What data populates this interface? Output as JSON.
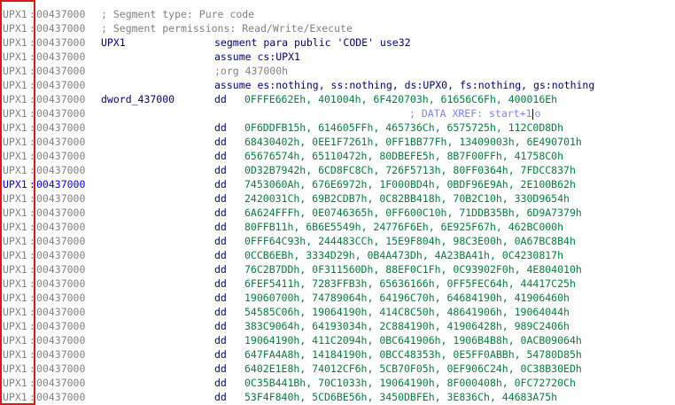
{
  "colors": {
    "address_grey": "#808080",
    "selected_blue": "#0000ff",
    "keyword_navy": "#000080",
    "operand_green": "#008040",
    "xref_blue": "#8080ff",
    "highlight_red": "#e0161b"
  },
  "rows": [
    {
      "seg": "UPX1",
      "addr": "00437000",
      "text": "; Segment type: Pure code"
    },
    {
      "seg": "UPX1",
      "addr": "00437000",
      "text": "; Segment permissions: Read/Write/Execute"
    },
    {
      "seg": "UPX1",
      "addr": "00437000",
      "label": "UPX1",
      "mnem": "segment para public 'CODE' use32"
    },
    {
      "seg": "UPX1",
      "addr": "00437000",
      "mnem": "assume cs:UPX1"
    },
    {
      "seg": "UPX1",
      "addr": "00437000",
      "comment": ";org 437000h"
    },
    {
      "seg": "UPX1",
      "addr": "00437000",
      "mnem": "assume es:nothing, ss:nothing, ds:UPX0, fs:nothing, gs:nothing"
    },
    {
      "seg": "UPX1",
      "addr": "00437000",
      "label": "dword_437000",
      "mnem": "dd",
      "ops": "0FFFE662Eh, 401004h, 6F420703h, 61656C6Fh, 400016Eh"
    },
    {
      "seg": "UPX1",
      "addr": "00437000",
      "xref_pre": "; DATA XREF: start+1",
      "xref_post": "o"
    },
    {
      "seg": "UPX1",
      "addr": "00437000",
      "mnem": "dd",
      "ops": "0F6DDFB15h, 614605FFh, 465736Ch, 6575725h, 112C0D8Dh"
    },
    {
      "seg": "UPX1",
      "addr": "00437000",
      "mnem": "dd",
      "ops": "68430402h, 0EE1F7261h, 0FF1BB77Fh, 13409003h, 6E490701h"
    },
    {
      "seg": "UPX1",
      "addr": "00437000",
      "mnem": "dd",
      "ops": "65676574h, 65110472h, 80DBEFE5h, 8B7F00FFh, 41758C0h"
    },
    {
      "seg": "UPX1",
      "addr": "00437000",
      "mnem": "dd",
      "ops": "0D32B7942h, 6CD8FC8Ch, 726F5713h, 80FF0364h, 7FDCC837h"
    },
    {
      "seg": "UPX1",
      "addr": "00437000",
      "selected": true,
      "mnem": "dd",
      "ops": "7453060Ah, 676E6972h, 1F000BD4h, 0BDF96E9Ah, 2E100B62h"
    },
    {
      "seg": "UPX1",
      "addr": "00437000",
      "mnem": "dd",
      "ops": "2420031Ch, 69B2CDB7h, 0C82BB418h, 70B2C10h, 330D9654h"
    },
    {
      "seg": "UPX1",
      "addr": "00437000",
      "mnem": "dd",
      "ops": "6A624FFFh, 0E0746365h, 0FF600C10h, 71DDB35Bh, 6D9A7379h"
    },
    {
      "seg": "UPX1",
      "addr": "00437000",
      "mnem": "dd",
      "ops": "80FFB11h, 6B6E5549h, 24776F6Eh, 6E925F67h, 462BC000h"
    },
    {
      "seg": "UPX1",
      "addr": "00437000",
      "mnem": "dd",
      "ops": "0FFF64C93h, 244483CCh, 15E9F804h, 98C3E00h, 0A67BC8B4h"
    },
    {
      "seg": "UPX1",
      "addr": "00437000",
      "mnem": "dd",
      "ops": "0CCB6EBh, 3334D29h, 0B4A473Dh, 4A23BA41h, 0C4230817h"
    },
    {
      "seg": "UPX1",
      "addr": "00437000",
      "mnem": "dd",
      "ops": "76C2B7DDh, 0F311560Dh, 88EF0C1Fh, 0C93902F0h, 4E804010h"
    },
    {
      "seg": "UPX1",
      "addr": "00437000",
      "mnem": "dd",
      "ops": "6FEF5411h, 7283FFB3h, 65636166h, 0FF5FEC64h, 44417C25h"
    },
    {
      "seg": "UPX1",
      "addr": "00437000",
      "mnem": "dd",
      "ops": "19060700h, 74789064h, 64196C70h, 64684190h, 41906460h"
    },
    {
      "seg": "UPX1",
      "addr": "00437000",
      "mnem": "dd",
      "ops": "54585C06h, 19064190h, 414C8C50h, 48641906h, 19064044h"
    },
    {
      "seg": "UPX1",
      "addr": "00437000",
      "mnem": "dd",
      "ops": "383C9064h, 64193034h, 2C884190h, 41906428h, 989C2406h"
    },
    {
      "seg": "UPX1",
      "addr": "00437000",
      "mnem": "dd",
      "ops": "19064190h, 411C2094h, 0BC641906h, 1906B4B8h, 0ACB09064h"
    },
    {
      "seg": "UPX1",
      "addr": "00437000",
      "mnem": "dd",
      "ops": "647FA4A8h, 14184190h, 0BCC48353h, 0E5FF0ABBh, 54780D85h"
    },
    {
      "seg": "UPX1",
      "addr": "00437000",
      "mnem": "dd",
      "ops": "6402E1E8h, 74012CF6h, 5CB70F05h, 0EF906C24h, 0C38B30EDh"
    },
    {
      "seg": "UPX1",
      "addr": "00437000",
      "mnem": "dd",
      "ops": "0C35B441Bh, 70C1033h, 19064190h, 8F000408h, 0FC72720Ch"
    },
    {
      "seg": "UPX1",
      "addr": "00437000",
      "mnem": "dd",
      "ops": "53F4F840h, 5CD6BE56h, 3450DBFEh, 3E836Ch, 44683A75h"
    }
  ]
}
